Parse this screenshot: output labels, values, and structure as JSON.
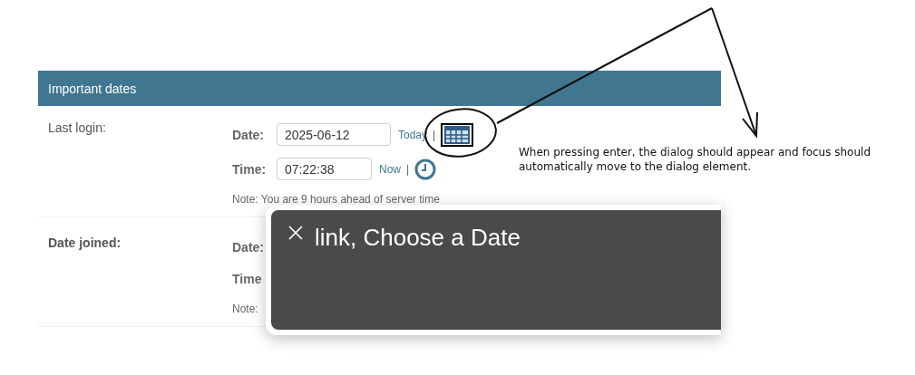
{
  "fieldset": {
    "title": "Important dates",
    "rows": [
      {
        "label": "Last login:",
        "required": false,
        "date": {
          "label": "Date:",
          "value": "2025-06-12",
          "shortcut": "Today",
          "separator": "|"
        },
        "time": {
          "label": "Time:",
          "value": "07:22:38",
          "shortcut": "Now",
          "separator": "|"
        },
        "note": "Note: You are 9 hours ahead of server time"
      },
      {
        "label": "Date joined:",
        "required": true,
        "date": {
          "label": "Date:"
        },
        "time": {
          "label": "Time"
        },
        "note": "Note:"
      }
    ]
  },
  "dialog": {
    "title": "link, Choose a Date"
  },
  "annotation": {
    "text": "When pressing enter, the dialog should appear and focus should automatically move to the dialog element."
  }
}
